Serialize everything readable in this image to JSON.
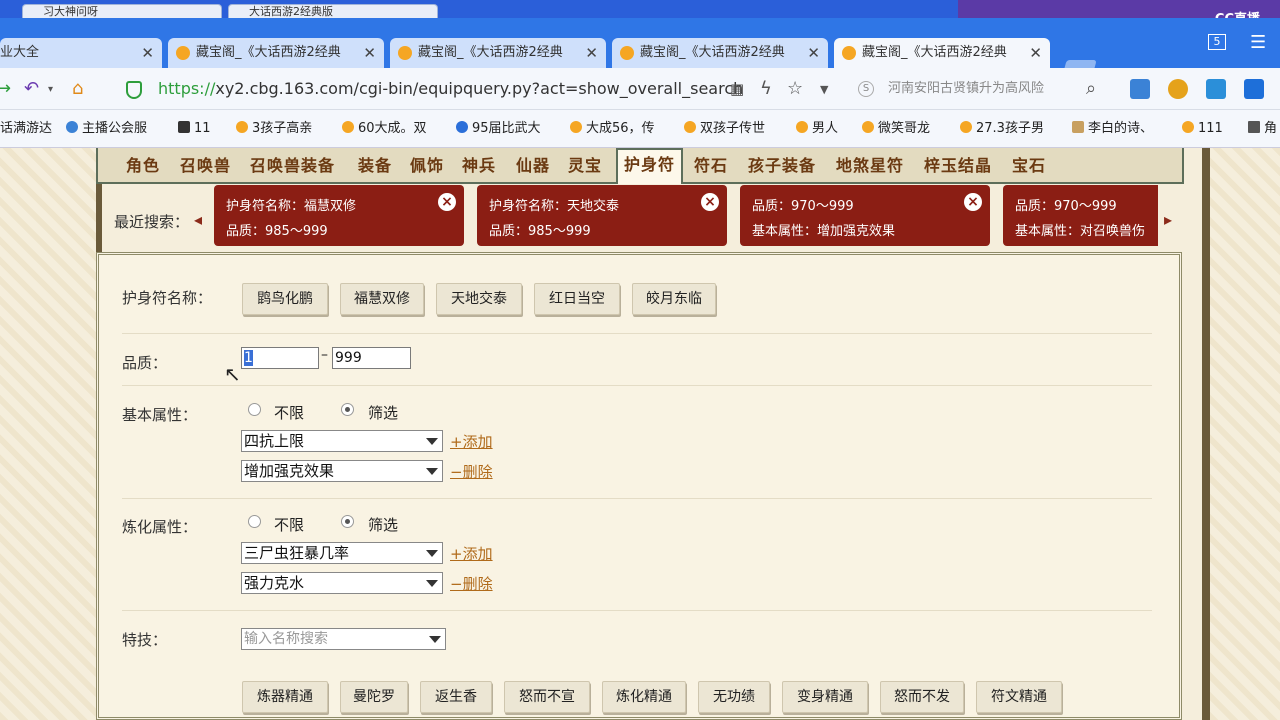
{
  "window": {
    "old_tabs": [
      "习大神问呀",
      "大话西游2经典版"
    ],
    "cc_logo": "CC直播",
    "tab_count": "5"
  },
  "tabs": [
    {
      "title": "业大全",
      "active": false
    },
    {
      "title": "藏宝阁_《大话西游2经典",
      "active": false
    },
    {
      "title": "藏宝阁_《大话西游2经典",
      "active": false
    },
    {
      "title": "藏宝阁_《大话西游2经典",
      "active": false
    },
    {
      "title": "藏宝阁_《大话西游2经典",
      "active": true
    }
  ],
  "address": {
    "protocol": "https://",
    "rest": "xy2.cbg.163.com/cgi-bin/equipquery.py?act=show_overall_search",
    "search_text": "河南安阳古贤镇升为高风险"
  },
  "bookmarks": [
    "话满游达",
    "主播公会服",
    "11",
    "3孩子高亲",
    "60大成。双",
    "95届比武大",
    "大成56，传",
    "双孩子传世",
    "男人",
    "微笑哥龙",
    "27.3孩子男",
    "李白的诗、",
    "111",
    "角"
  ],
  "categories": [
    "角色",
    "召唤兽",
    "召唤兽装备",
    "装备",
    "佩饰",
    "神兵",
    "仙器",
    "灵宝",
    "护身符",
    "符石",
    "孩子装备",
    "地煞星符",
    "梓玉结晶",
    "宝石"
  ],
  "active_category": "护身符",
  "recent": {
    "label": "最近搜索：",
    "chips": [
      {
        "line1": "护身符名称：福慧双修",
        "line2": "品质：985～999"
      },
      {
        "line1": "护身符名称：天地交泰",
        "line2": "品质：985～999"
      },
      {
        "line1": "品质：970～999",
        "line2": "基本属性：增加强克效果"
      },
      {
        "line1": "品质：970～999",
        "line2": "基本属性：对召唤兽伤"
      }
    ]
  },
  "form": {
    "name_label": "护身符名称：",
    "names": [
      "鹍鸟化鹏",
      "福慧双修",
      "天地交泰",
      "红日当空",
      "皎月东临"
    ],
    "quality_label": "品质：",
    "quality_min": "1",
    "quality_max": "999",
    "basic_label": "基本属性：",
    "refine_label": "炼化属性：",
    "opt_unlimited": "不限",
    "opt_filter": "筛选",
    "basic_selects": [
      "四抗上限",
      "增加强克效果"
    ],
    "refine_selects": [
      "三尸虫狂暴几率",
      "强力克水"
    ],
    "add_link": "+添加",
    "del_link": "−删除",
    "skill_label": "特技：",
    "skill_placeholder": "输入名称搜索",
    "skills": [
      "炼器精通",
      "曼陀罗",
      "返生香",
      "怒而不宣",
      "炼化精通",
      "无功绩",
      "变身精通",
      "怒而不发",
      "符文精通"
    ]
  }
}
